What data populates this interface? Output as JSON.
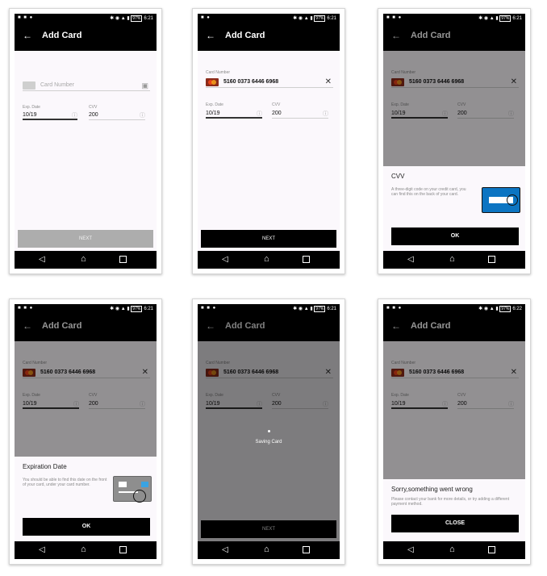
{
  "status": {
    "time_a": "6:21",
    "time_b": "6:22",
    "battery": "97%"
  },
  "appbar": {
    "title": "Add Card"
  },
  "form": {
    "card_number_label": "Card Number",
    "card_number_placeholder": "Card Number",
    "card_number_value": "5160 0373 6446 6968",
    "exp_label": "Exp. Date",
    "exp_value": "10/19",
    "cvv_label": "CVV",
    "cvv_value": "200",
    "next_label": "NEXT"
  },
  "cvv_sheet": {
    "title": "CVV",
    "body": "A three-digit code on your credit card, you can find this on the back of your card.",
    "ok": "OK"
  },
  "exp_sheet": {
    "title": "Expiration Date",
    "body": "You should be able to find this date on the front of your card, under your card number.",
    "ok": "OK"
  },
  "saving": {
    "text": "Saving Card"
  },
  "error_sheet": {
    "title": "Sorry,something went wrong",
    "body": "Please contact your bank for more details, or try adding a different payment method.",
    "close": "CLOSE"
  },
  "icons": {
    "back": "arrow-left-icon",
    "camera": "camera-icon",
    "info": "info-icon",
    "clear": "close-icon",
    "nav_back": "nav-back-icon",
    "nav_home": "nav-home-icon",
    "nav_recent": "nav-recent-icon"
  }
}
